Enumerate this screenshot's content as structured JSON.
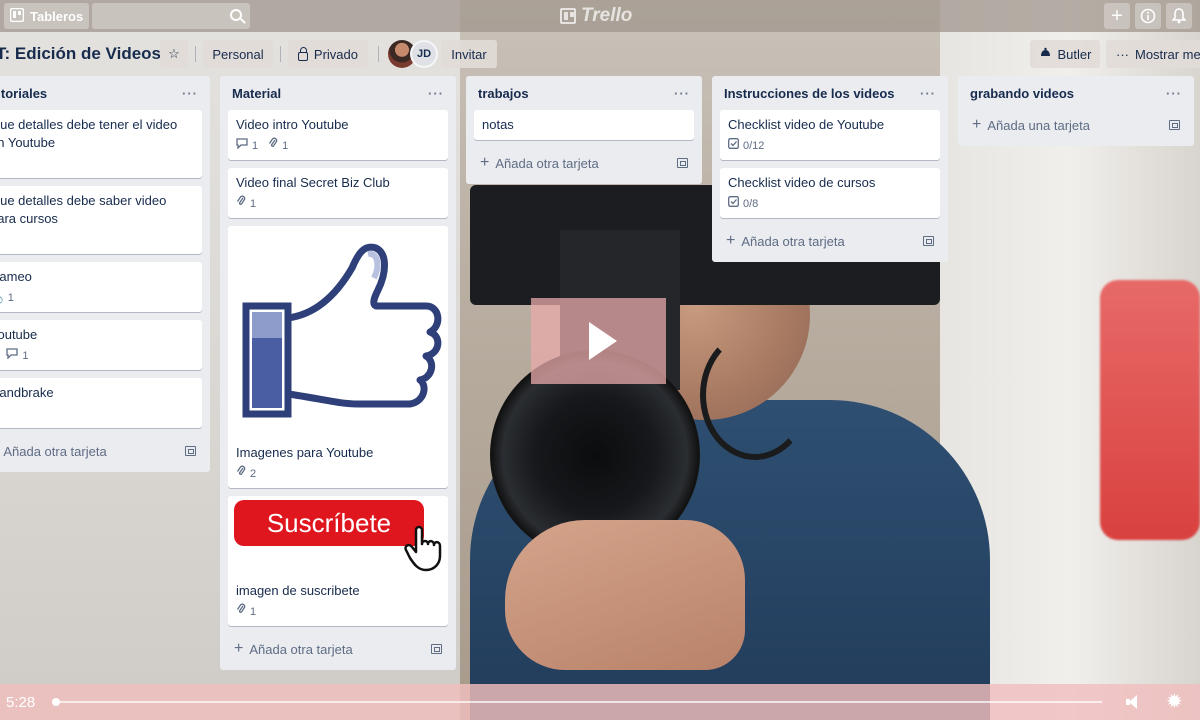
{
  "topbar": {
    "boards_label": "Tableros",
    "logo_text": "Trello"
  },
  "board": {
    "title": "T: Edición de Videos",
    "personal_label": "Personal",
    "private_label": "Privado",
    "avatar_initials": "JD",
    "invite_label": "Invitar",
    "butler_label": "Butler",
    "menu_label": "Mostrar menú"
  },
  "lists": [
    {
      "title": "Tutoriales",
      "cards": [
        {
          "title": "Que detalles debe tener el video en Youtube",
          "comments": "",
          "attachments": ""
        },
        {
          "title": "Que detalles debe saber video para cursos",
          "comments": "",
          "attachments": ""
        },
        {
          "title": "Dameo",
          "attachments": "1"
        },
        {
          "title": "Youtube",
          "comments": "1"
        },
        {
          "title": "Handbrake"
        }
      ],
      "add_label": "Añada otra tarjeta"
    },
    {
      "title": "Material",
      "cards": [
        {
          "title": "Video intro Youtube",
          "comments": "1",
          "attachments": "1"
        },
        {
          "title": "Video final Secret Biz Club",
          "attachments": "1"
        },
        {
          "title": "Imagenes para Youtube",
          "attachments": "2"
        },
        {
          "title": "imagen de suscribete",
          "attachments": "1",
          "cover_text": "Suscríbete"
        }
      ],
      "add_label": "Añada otra tarjeta"
    },
    {
      "title": "trabajos",
      "cards": [
        {
          "title": "notas"
        }
      ],
      "add_label": "Añada otra tarjeta"
    },
    {
      "title": "Instrucciones de los videos",
      "cards": [
        {
          "title": "Checklist video de Youtube",
          "checklist": "0/12"
        },
        {
          "title": "Checklist video de cursos",
          "checklist": "0/8"
        }
      ],
      "add_label": "Añada otra tarjeta"
    },
    {
      "title": "grabando videos",
      "cards": [],
      "add_label": "Añada una tarjeta"
    }
  ],
  "video": {
    "time": "5:28",
    "progress": 0.004
  },
  "icons": [
    "boards-icon",
    "search-icon",
    "plus-icon",
    "info-icon",
    "bell-icon",
    "star-icon",
    "lock-icon",
    "comment-icon",
    "attachment-icon",
    "checklist-icon",
    "template-icon",
    "play-icon",
    "volume-icon",
    "settings-icon"
  ],
  "colors": {
    "list_bg": "#ebecf0",
    "card_bg": "#ffffff",
    "text": "#172b4d",
    "subscribe_red": "#e0161e",
    "controls_bg": "#f0bebe"
  }
}
